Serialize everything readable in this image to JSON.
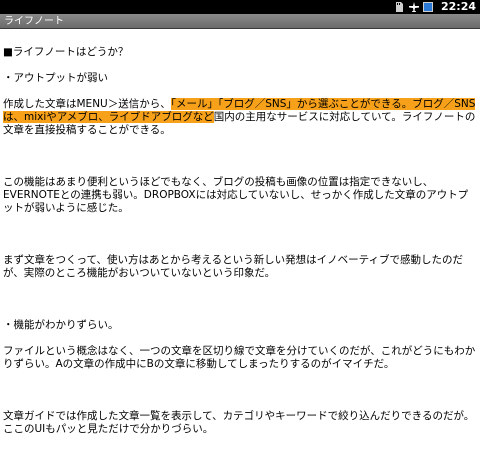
{
  "status_bar": {
    "time": "22:24"
  },
  "app": {
    "title": "ライフノート"
  },
  "note": {
    "heading": "■ライフノートはどうか？",
    "point1": "・アウトプットが弱い",
    "para1_before": "作成した文章はMENU＞送信から、",
    "para1_highlight": "「メール」「ブログ／SNS」から選ぶことができる。ブログ／SNSは、mixiやアメブロ、ライブドアブログなど",
    "para1_after": "国内の主用なサービスに対応していて。ライフノートの文章を直接投稿することができる。",
    "para2": "この機能はあまり便利というほどでもなく、ブログの投稿も画像の位置は指定できないし、EVERNOTEとの連携も弱い。DROPBOXには対応していないし、せっかく作成した文章のアウトプットが弱いように感じた。",
    "para3": "まず文章をつくって、使い方はあとから考えるという新しい発想はイノベーティブで感動したのだが、実際のところ機能がおいついていないという印象だ。",
    "point2": "・機能がわかりずらい。",
    "para4": "ファイルという概念はなく、一つの文章を区切り線で文章を分けていくのだが、これがどうにもわかりずらい。Aの文章の作成中にBの文章に移動してしまったりするのがイマイチだ。",
    "para5": "文章ガイドでは作成した文章一覧を表示して、カテゴリやキーワードで絞り込んだりできるのだが。ここのUIもパッと見ただけで分かりづらい。"
  }
}
